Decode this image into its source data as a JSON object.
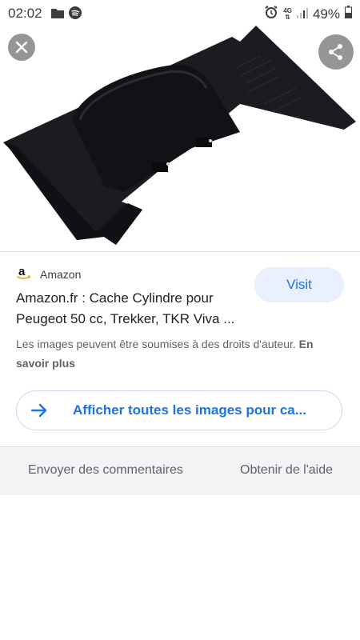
{
  "status_bar": {
    "time": "02:02",
    "network": "4G",
    "battery_percent": "49%"
  },
  "viewer": {
    "image_alt": "Cache Cylindre"
  },
  "result": {
    "source": "Amazon",
    "visit_label": "Visit",
    "title": "Amazon.fr : Cache Cylindre pour Peugeot 50 cc, Trekker, TKR Viva ...",
    "copyright_text": "Les images peuvent être soumises à des droits d'auteur.",
    "copyright_more": "En savoir plus",
    "show_all_label": "Afficher toutes les images pour ca..."
  },
  "footer": {
    "feedback_label": "Envoyer des commentaires",
    "help_label": "Obtenir de l'aide"
  },
  "colors": {
    "accent": "#1a73e8",
    "visit_bg": "#e8f0fe",
    "footer_bg": "#f1f3f4"
  }
}
